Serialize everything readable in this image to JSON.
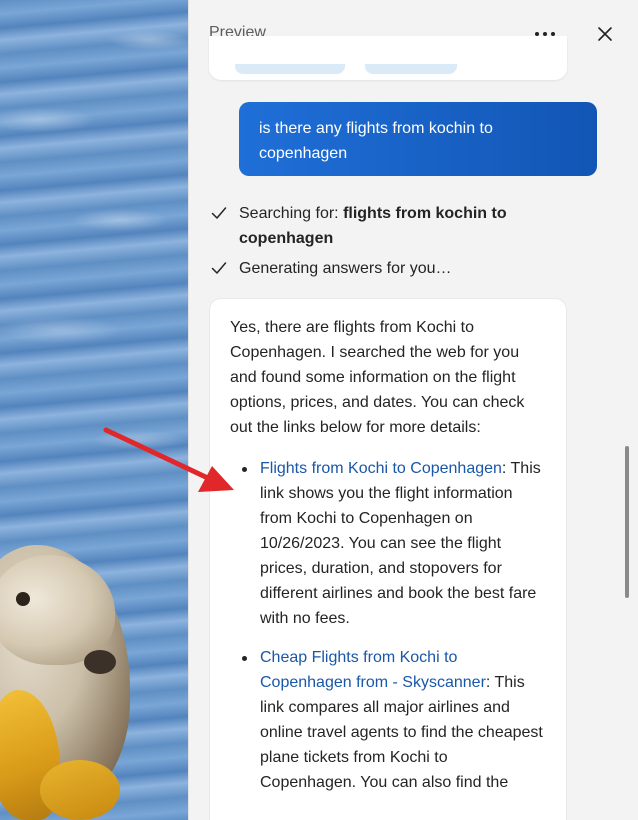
{
  "panel": {
    "title": "Preview",
    "more_icon": "more-horizontal-icon",
    "close_icon": "close-icon"
  },
  "conversation": {
    "user_message": "is there any flights from kochin to copenhagen",
    "status": [
      {
        "prefix": "Searching for: ",
        "bold": "flights from kochin to copenhagen",
        "icon": "checkmark-icon"
      },
      {
        "prefix": "Generating answers for you…",
        "bold": "",
        "icon": "checkmark-icon"
      }
    ],
    "answer": {
      "intro": "Yes, there are flights from Kochi to Copenhagen. I searched the web for you and found some information on the flight options, prices, and dates. You can check out the links below for more details:",
      "items": [
        {
          "link": "Flights from Kochi to Copenhagen",
          "text": ": This link shows you the flight information from Kochi to Copenhagen on 10/26/2023. You can see the flight prices, duration, and stopovers for different airlines and book the best fare with no fees."
        },
        {
          "link": "Cheap Flights from Kochi to Copenhagen from - Skyscanner",
          "text": ": This link compares all major airlines and online travel agents to find the cheapest plane tickets from Kochi to Copenhagen. You can also find the"
        }
      ]
    }
  },
  "colors": {
    "user_bubble": "#1f6fd8",
    "link": "#1a57a8",
    "annotation_arrow": "#e0282a",
    "panel_bg": "#f3f3f3"
  }
}
